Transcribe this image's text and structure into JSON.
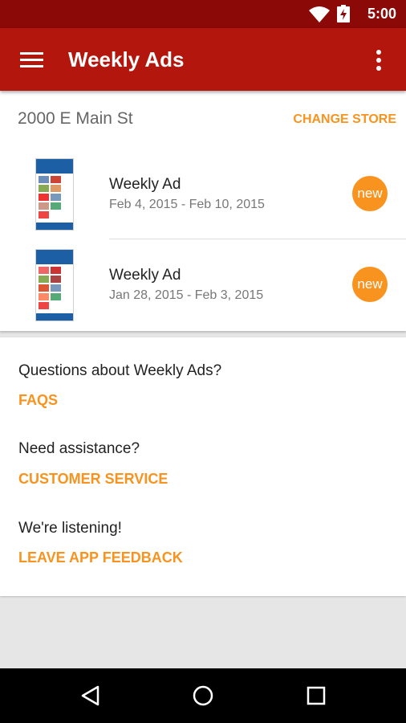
{
  "status_bar": {
    "time": "5:00"
  },
  "app_bar": {
    "title": "Weekly Ads"
  },
  "store": {
    "name": "2000 E Main St",
    "change_label": "CHANGE STORE"
  },
  "ads": [
    {
      "title": "Weekly Ad",
      "dates": "Feb 4, 2015 - Feb 10, 2015",
      "badge": "new"
    },
    {
      "title": "Weekly Ad",
      "dates": "Jan 28, 2015 - Feb 3, 2015",
      "badge": "new"
    }
  ],
  "help": [
    {
      "question": "Questions about Weekly Ads?",
      "link": "FAQS"
    },
    {
      "question": "Need assistance?",
      "link": "CUSTOMER SERVICE"
    },
    {
      "question": "We're listening!",
      "link": "LEAVE APP FEEDBACK"
    }
  ],
  "colors": {
    "status_bar": "#8b0a07",
    "app_bar": "#b2160c",
    "accent": "#f7931e"
  },
  "icons": [
    "wifi-icon",
    "battery-charging-icon",
    "menu-icon",
    "overflow-menu-icon",
    "back-icon",
    "home-icon",
    "recent-apps-icon"
  ]
}
